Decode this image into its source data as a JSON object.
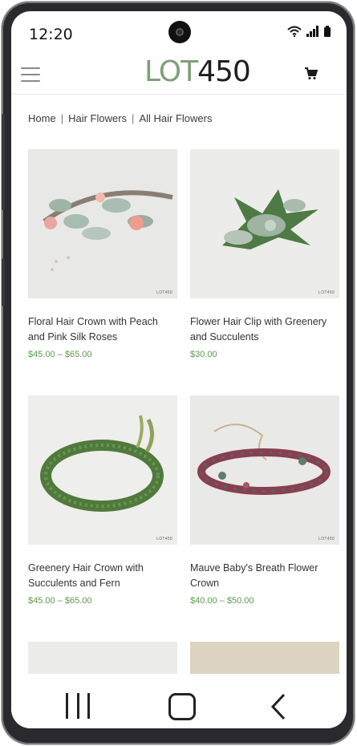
{
  "status_bar": {
    "time": "12:20",
    "icons": [
      "wifi-icon",
      "signal-icon",
      "battery-icon"
    ]
  },
  "header": {
    "logo_lot": "LOT",
    "logo_num": "450",
    "menu_icon": "hamburger-menu-icon",
    "cart_icon": "cart-icon"
  },
  "breadcrumb": {
    "items": [
      "Home",
      "Hair Flowers",
      "All Hair Flowers"
    ],
    "separator": "|"
  },
  "products": [
    {
      "title": "Floral Hair Crown with Peach and Pink Silk Roses",
      "price": "$45.00 – $65.00",
      "image_tag": "LOT450"
    },
    {
      "title": "Flower Hair Clip with Greenery and Succulents",
      "price": "$30.00",
      "image_tag": "LOT450"
    },
    {
      "title": "Greenery Hair Crown with Succulents and Fern",
      "price": "$45.00 – $65.00",
      "image_tag": "LOT450"
    },
    {
      "title": "Mauve Baby's Breath Flower Crown",
      "price": "$40.00 – $50.00",
      "image_tag": "LOT450"
    }
  ],
  "nav_bar": {
    "recent_icon": "recent-apps-icon",
    "home_icon": "home-icon",
    "back_icon": "back-icon"
  },
  "colors": {
    "logo_accent": "#7fa07a",
    "price": "#5d9a4c"
  }
}
